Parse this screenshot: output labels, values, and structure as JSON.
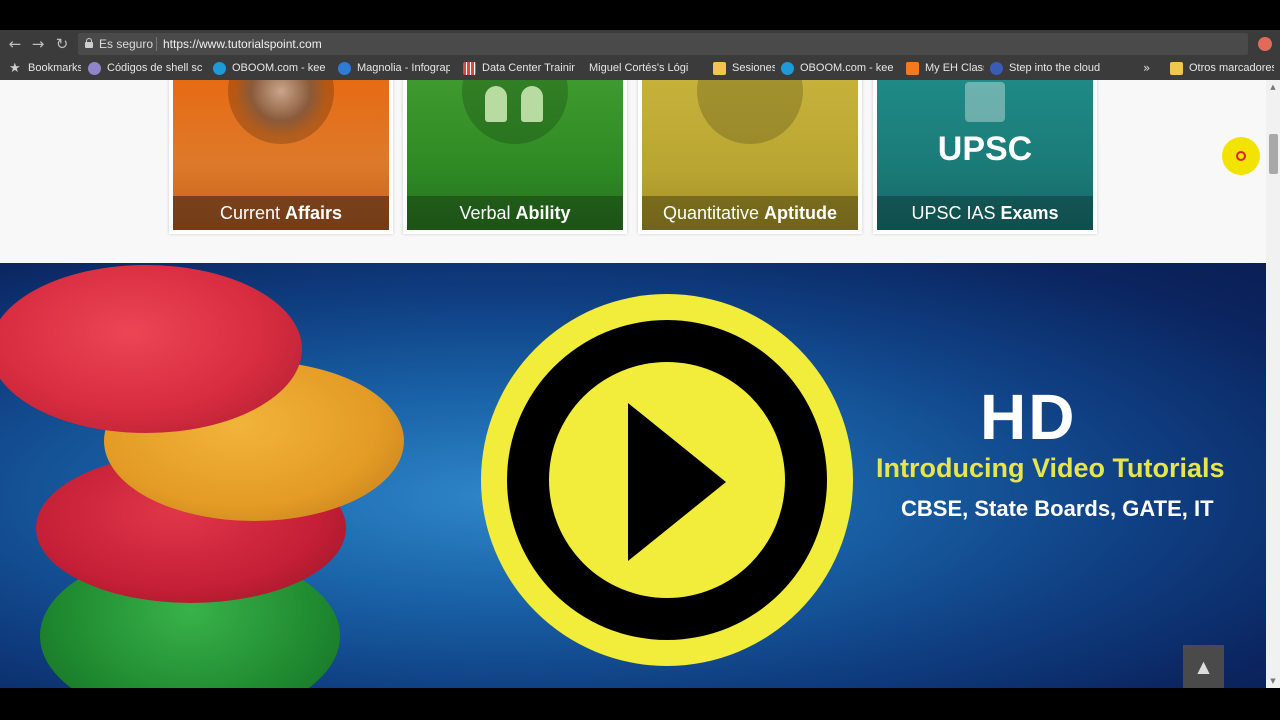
{
  "browser": {
    "security_label": "Es seguro",
    "url": "https://www.tutorialspoint.com",
    "bookmarks": [
      {
        "label": "Bookmarks",
        "icon": "star-icon"
      },
      {
        "label": "Códigos de shell scrip",
        "icon": "bookmark-site-icon"
      },
      {
        "label": "OBOOM.com - keep",
        "icon": "oboom-icon"
      },
      {
        "label": "Magnolia - Infograpl",
        "icon": "magnolia-icon"
      },
      {
        "label": "Data Center Training",
        "icon": "grid-site-icon"
      },
      {
        "label": "Miguel Cortés's Lógi",
        "icon": "page-icon"
      },
      {
        "label": "Sesiones",
        "icon": "folder-icon"
      },
      {
        "label": "OBOOM.com - keep",
        "icon": "oboom-icon"
      },
      {
        "label": "My EH Class",
        "icon": "blogger-icon"
      },
      {
        "label": "Step into the cloud",
        "icon": "cloud-icon"
      }
    ],
    "more_label": "»",
    "other_bookmarks": "Otros marcadores"
  },
  "cards": [
    {
      "label": "Current",
      "bold": "Affairs",
      "color": "#e9691a"
    },
    {
      "label": "Verbal",
      "bold": "Ability",
      "color": "#3a8a2a"
    },
    {
      "label": "Quantitative",
      "bold": "Aptitude",
      "color": "#b7a52a"
    },
    {
      "label": "UPSC IAS",
      "bold": "Exams",
      "color": "#1e7f7b",
      "badge": "UPSC"
    }
  ],
  "hero": {
    "hd": "HD",
    "title": "Introducing Video Tutorials",
    "subtitle": "CBSE, State Boards, GATE, IT",
    "play_color": "#f2ec3a"
  },
  "back_to_top": "▲"
}
